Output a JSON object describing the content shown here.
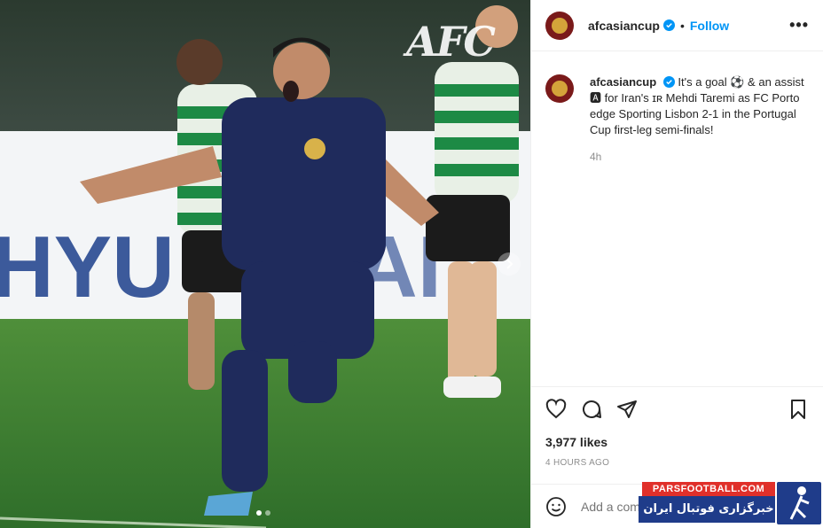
{
  "photo": {
    "logo_text": "AFC",
    "carousel": {
      "total": 2,
      "current": 1
    }
  },
  "header": {
    "username": "afcasiancup",
    "separator": "•",
    "follow_label": "Follow",
    "more_label": "•••"
  },
  "caption": {
    "username": "afcasiancup",
    "text": "It's a goal ⚽ & an assist 🅰 for Iran's ɪʀ Mehdi Taremi as FC Porto edge Sporting Lisbon 2-1 in the Portugal Cup first-leg semi-finals!",
    "time": "4h"
  },
  "stats": {
    "likes": "3,977 likes",
    "ago": "4 HOURS AGO"
  },
  "comment": {
    "placeholder": "Add a comment..."
  },
  "watermark": {
    "top": "PARSFOOTBALL.COM",
    "main": "خبرگزاری فوتبال ایران"
  },
  "colors": {
    "follow": "#0095f6",
    "avatar": "#7a1a1a",
    "secondary_text": "#8e8e8e"
  }
}
